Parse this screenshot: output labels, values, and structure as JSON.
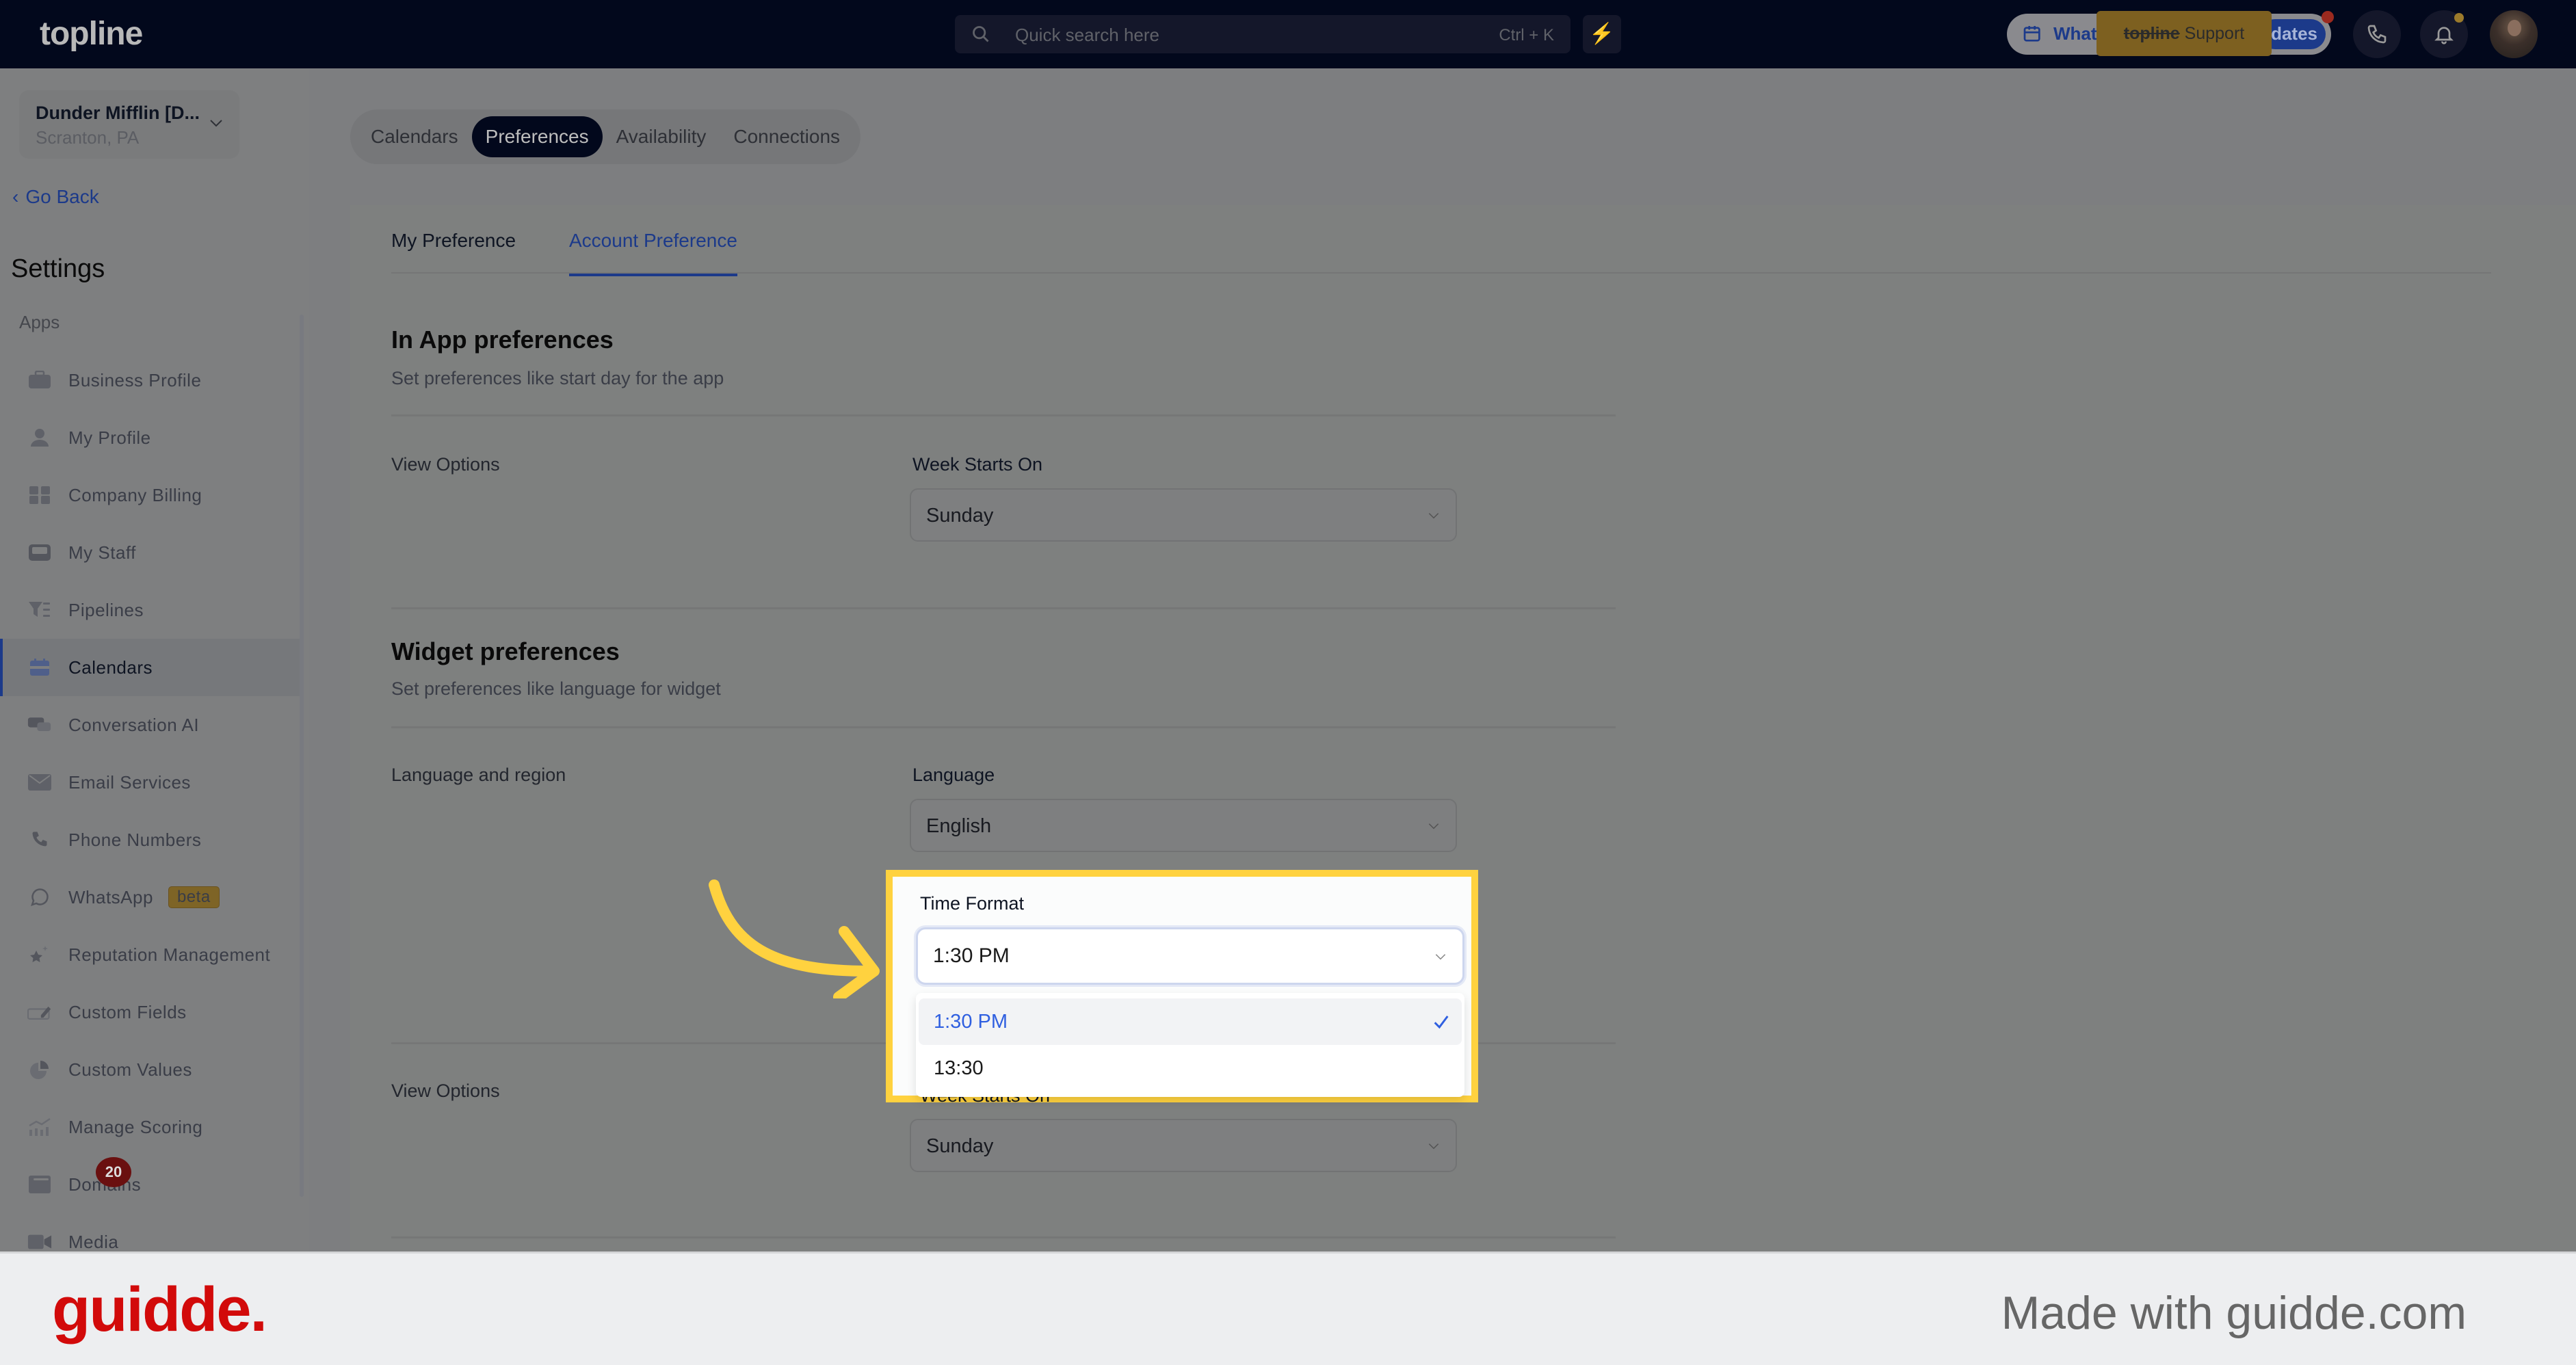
{
  "app": {
    "logo": "topline",
    "search_placeholder": "Quick search here",
    "search_shortcut": "Ctrl + K",
    "whats_new_left": "What",
    "whats_new_right": "dates",
    "support_tooltip_brand": "topline",
    "support_tooltip_text": " Support"
  },
  "sidebar": {
    "location_name": "Dunder Mifflin [D...",
    "location_city": "Scranton, PA",
    "go_back": "Go Back",
    "title": "Settings",
    "section": "Apps",
    "items": [
      {
        "label": "Business Profile",
        "icon": "briefcase-icon"
      },
      {
        "label": "My Profile",
        "icon": "user-icon"
      },
      {
        "label": "Company Billing",
        "icon": "calculator-icon"
      },
      {
        "label": "My Staff",
        "icon": "inbox-icon"
      },
      {
        "label": "Pipelines",
        "icon": "filter-list-icon"
      },
      {
        "label": "Calendars",
        "icon": "calendar-icon",
        "active": true
      },
      {
        "label": "Conversation AI",
        "icon": "chat-icon"
      },
      {
        "label": "Email Services",
        "icon": "email-icon"
      },
      {
        "label": "Phone Numbers",
        "icon": "phone-icon"
      },
      {
        "label": "WhatsApp",
        "icon": "whatsapp-icon",
        "badge": "beta"
      },
      {
        "label": "Reputation Management",
        "icon": "star-sparkle-icon"
      },
      {
        "label": "Custom Fields",
        "icon": "edit-field-icon"
      },
      {
        "label": "Custom Values",
        "icon": "pie-chart-icon"
      },
      {
        "label": "Manage Scoring",
        "icon": "chart-trend-icon"
      },
      {
        "label": "Domains",
        "icon": "browser-window-icon"
      },
      {
        "label": "Media",
        "icon": "video-camera-icon"
      }
    ],
    "notification_count": "20"
  },
  "main": {
    "tabs": [
      "Calendars",
      "Preferences",
      "Availability",
      "Connections"
    ],
    "active_tab": "Preferences",
    "sub_tabs": [
      "My Preference",
      "Account Preference"
    ],
    "active_sub_tab": "Account Preference",
    "in_app": {
      "title": "In App preferences",
      "description": "Set preferences like start day for the app",
      "row_label": "View Options",
      "field_label": "Week Starts On",
      "field_value": "Sunday"
    },
    "widget": {
      "title": "Widget preferences",
      "description": "Set preferences like language for widget",
      "row_label": "Language and region",
      "language_label": "Language",
      "language_value": "English",
      "time_format_label": "Time Format",
      "time_format_value": "1:30 PM",
      "time_format_options": [
        "1:30 PM",
        "13:30"
      ],
      "time_format_selected": "1:30 PM",
      "view_options_label": "View Options",
      "week_starts_label": "Week Starts On",
      "week_starts_value": "Sunday"
    }
  },
  "footer": {
    "brand": "guidde.",
    "made_with": "Made with guidde.com"
  },
  "colors": {
    "accent": "#1c3a8a",
    "highlight": "#ffd23f",
    "selected_option": "#2f5fe0",
    "topbar": "#02081c",
    "brand_red": "#d20a0a"
  }
}
